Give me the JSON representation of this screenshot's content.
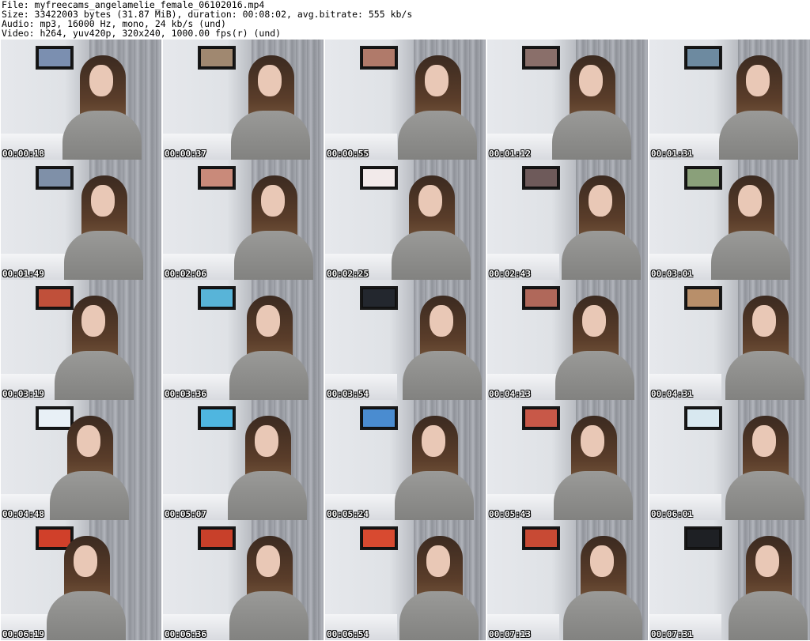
{
  "header": {
    "file_line": "File: myfreecams_angelamelie_female_06102016.mp4",
    "size_line": "Size: 33422003 bytes (31.87 MiB), duration: 00:08:02, avg.bitrate: 555 kb/s",
    "audio_line": "Audio: mp3, 16000 Hz, mono, 24 kb/s (und)",
    "video_line": "Video: h264, yuv420p, 320x240, 1000.00 fps(r) (und)"
  },
  "thumbnails": [
    {
      "time": "00:00:18",
      "tv_color": "#7b8fb0"
    },
    {
      "time": "00:00:37",
      "tv_color": "#a08870"
    },
    {
      "time": "00:00:55",
      "tv_color": "#b07a6a"
    },
    {
      "time": "00:01:12",
      "tv_color": "#8a6f6a"
    },
    {
      "time": "00:01:31",
      "tv_color": "#6d8aa0"
    },
    {
      "time": "00:01:49",
      "tv_color": "#7f90a8"
    },
    {
      "time": "00:02:06",
      "tv_color": "#c98a7a"
    },
    {
      "time": "00:02:25",
      "tv_color": "#f2eaea"
    },
    {
      "time": "00:02:43",
      "tv_color": "#6e5a5a"
    },
    {
      "time": "00:03:01",
      "tv_color": "#8aa07a"
    },
    {
      "time": "00:03:19",
      "tv_color": "#c0503a"
    },
    {
      "time": "00:03:36",
      "tv_color": "#58b4d8"
    },
    {
      "time": "00:03:54",
      "tv_color": "#23272e"
    },
    {
      "time": "00:04:13",
      "tv_color": "#b0685a"
    },
    {
      "time": "00:04:31",
      "tv_color": "#b88f6a"
    },
    {
      "time": "00:04:48",
      "tv_color": "#e8f0f6"
    },
    {
      "time": "00:05:07",
      "tv_color": "#4fb6e0"
    },
    {
      "time": "00:05:24",
      "tv_color": "#4a8cd0"
    },
    {
      "time": "00:05:43",
      "tv_color": "#c85848"
    },
    {
      "time": "00:06:01",
      "tv_color": "#d8e8f0"
    },
    {
      "time": "00:06:19",
      "tv_color": "#d0402a"
    },
    {
      "time": "00:06:36",
      "tv_color": "#c8402a"
    },
    {
      "time": "00:06:54",
      "tv_color": "#d84a30"
    },
    {
      "time": "00:07:13",
      "tv_color": "#c84a34"
    },
    {
      "time": "00:07:31",
      "tv_color": "#1e2024"
    }
  ]
}
